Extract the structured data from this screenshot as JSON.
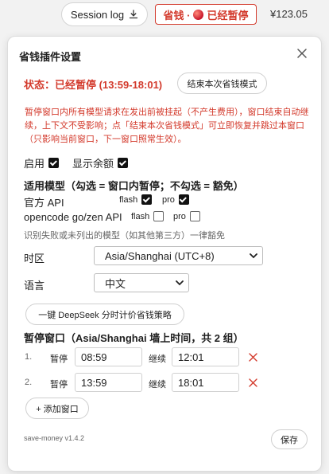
{
  "topbar": {
    "session_log": "Session log",
    "status_chip_prefix": "省钱 ·",
    "status_chip_text": "已经暂停",
    "balance": "¥123.05"
  },
  "panel": {
    "title": "省钱插件设置",
    "status_label": "状态：已经暂停",
    "status_time": "(13:59-18:01)",
    "end_button": "结束本次省钱模式",
    "description": "暂停窗口内所有模型请求在发出前被挂起（不产生费用），窗口结束自动继续，上下文不受影响；点「结束本次省钱模式」可立即恢复并跳过本窗口（只影响当前窗口，下一窗口照常生效）。",
    "enable_label": "启用",
    "enable_checked": true,
    "show_balance_label": "显示余额",
    "show_balance_checked": true,
    "models_title": "适用模型（勾选 = 窗口内暂停；不勾选 = 豁免）",
    "providers": [
      {
        "name": "官方 API",
        "flash_label": "flash",
        "flash_checked": true,
        "pro_label": "pro",
        "pro_checked": true
      },
      {
        "name": "opencode go/zen API",
        "flash_label": "flash",
        "flash_checked": false,
        "pro_label": "pro",
        "pro_checked": false
      }
    ],
    "models_note": "识别失败或未列出的模型（如其他第三方）一律豁免",
    "timezone_label": "时区",
    "timezone_value": "Asia/Shanghai (UTC+8)",
    "language_label": "语言",
    "language_value": "中文",
    "deepseek_button": "一键 DeepSeek 分时计价省钱策略",
    "windows_title": "暂停窗口（Asia/Shanghai 墙上时间，共 2 组）",
    "windows": [
      {
        "index": "1.",
        "pause_label": "暂停",
        "start": "08:59",
        "resume_label": "继续",
        "end": "12:01"
      },
      {
        "index": "2.",
        "pause_label": "暂停",
        "start": "13:59",
        "resume_label": "继续",
        "end": "18:01"
      }
    ],
    "add_window_button": "+ 添加窗口",
    "version": "save-money v1.4.2",
    "save_button": "保存"
  },
  "colors": {
    "accent_red": "#d33a2c"
  }
}
